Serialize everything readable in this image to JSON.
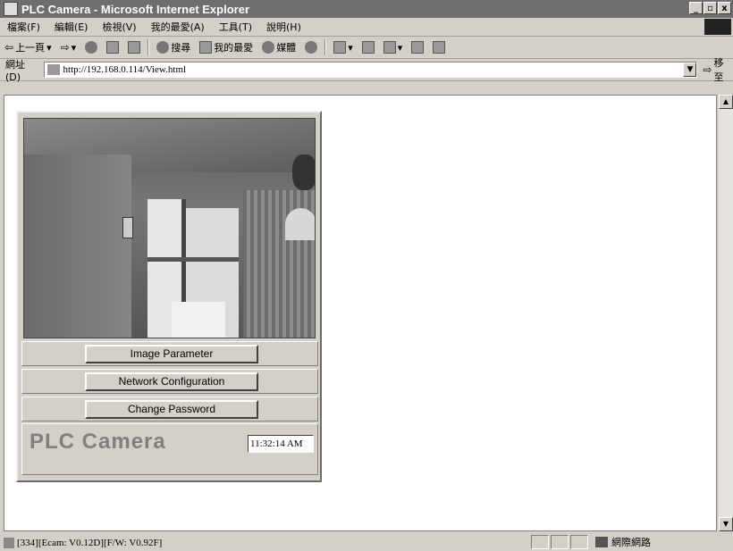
{
  "window": {
    "title": "PLC Camera - Microsoft Internet Explorer",
    "min": "_",
    "max": "▫",
    "close": "x"
  },
  "menu": [
    "檔案(F)",
    "編輯(E)",
    "檢視(V)",
    "我的最愛(A)",
    "工具(T)",
    "說明(H)"
  ],
  "toolbar": {
    "back": "上一頁",
    "search": "搜尋",
    "favorites": "我的最愛",
    "media": "媒體"
  },
  "address": {
    "label": "網址(D)",
    "url": "http://192.168.0.114/View.html",
    "go": "移至"
  },
  "panel": {
    "buttons": [
      "Image Parameter",
      "Network Configuration",
      "Change Password"
    ],
    "brand": "PLC Camera",
    "clock": "11:32:14 AM"
  },
  "status": {
    "text": "[334][Ecam: V0.12D][F/W: V0.92F]",
    "zone": "網際網路"
  }
}
